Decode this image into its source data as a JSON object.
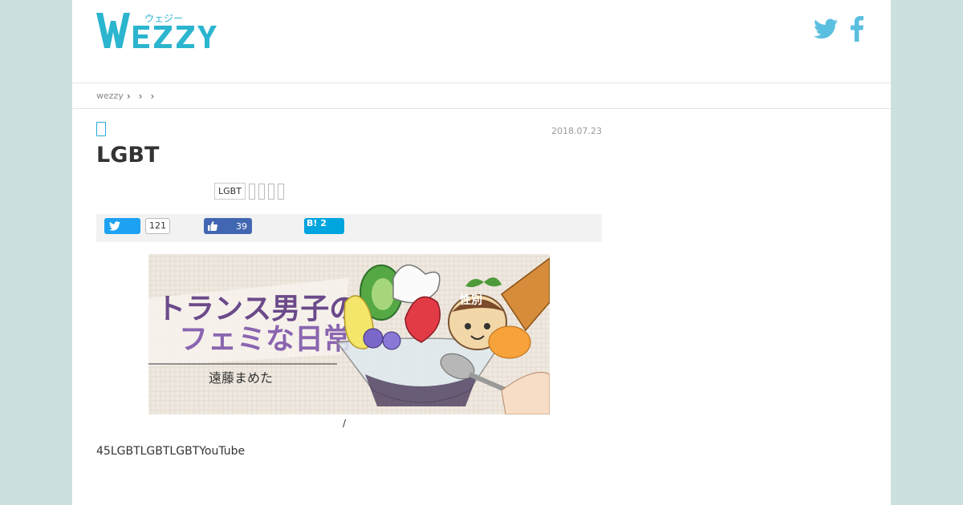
{
  "header": {
    "logo_text": "WEZZY",
    "logo_kana": "ウェジー",
    "twitter_icon": "twitter-icon",
    "facebook_icon": "facebook-icon",
    "brand_color": "#2bb5cf"
  },
  "breadcrumb": {
    "home": "wezzy",
    "separators": [
      "›",
      "›",
      "›"
    ]
  },
  "article": {
    "date": "2018.07.23",
    "title": "LGBT",
    "tags": [
      "LGBT"
    ],
    "share": {
      "twitter_count": "121",
      "facebook_count": "39",
      "hatena_label": "B!",
      "hatena_count": "2"
    },
    "hero": {
      "title_line1": "トランス男子の",
      "title_line2": "フェミな日常",
      "author": "遠藤まめた",
      "badge": "性別"
    },
    "caption": "/",
    "body": "45LGBTLGBTLGBTYouTube"
  }
}
